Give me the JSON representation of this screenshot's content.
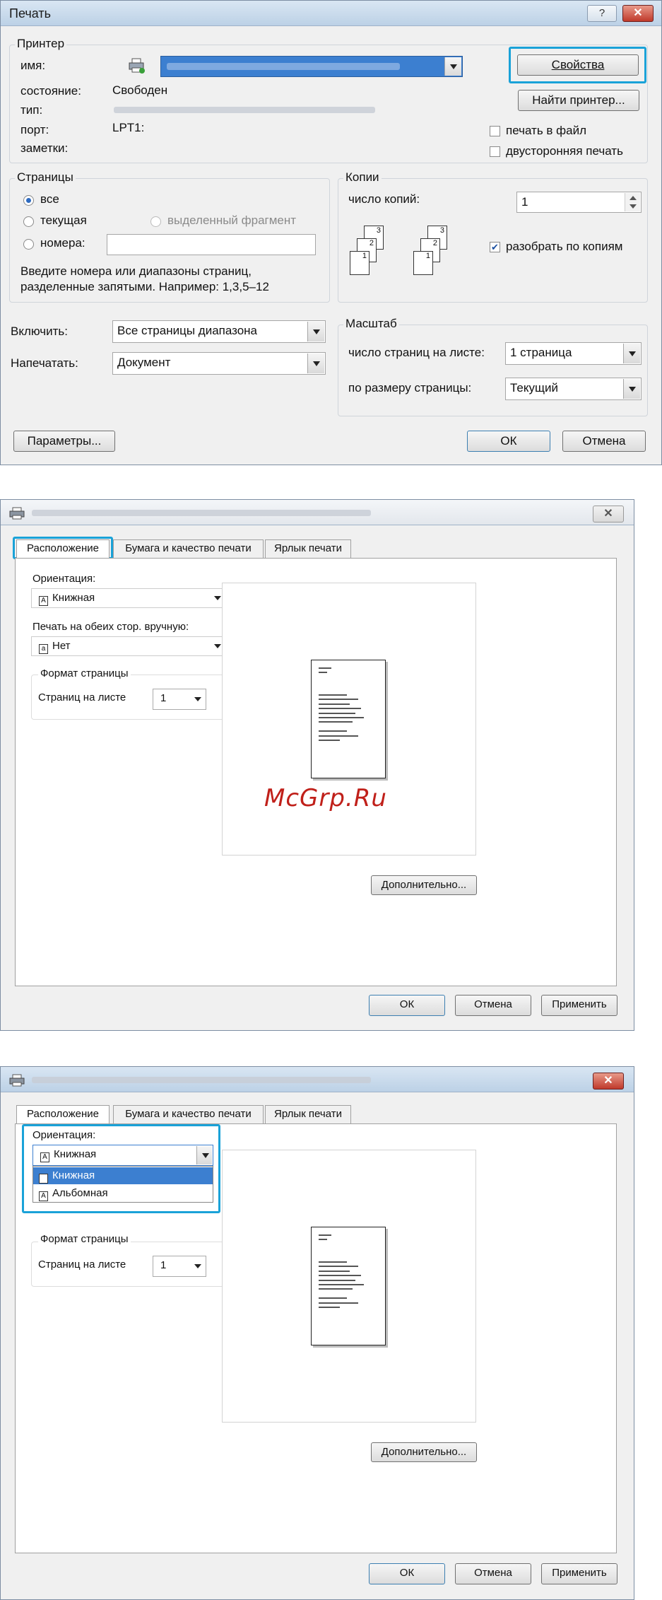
{
  "dialog1": {
    "title": "Печать",
    "printer_group": "Принтер",
    "name_label": "имя:",
    "status_label": "состояние:",
    "status_value": "Свободен",
    "type_label": "тип:",
    "port_label": "порт:",
    "port_value": "LPT1:",
    "notes_label": "заметки:",
    "properties_button": "Свойства",
    "find_printer_button": "Найти принтер...",
    "print_to_file": "печать в файл",
    "duplex": "двусторонняя печать",
    "pages_group": "Страницы",
    "all": "все",
    "current": "текущая",
    "selection": "выделенный фрагмент",
    "pages": "номера:",
    "hint_line1": "Введите номера или диапазоны страниц,",
    "hint_line2": "разделенные запятыми. Например: 1,3,5–12",
    "copies_group": "Копии",
    "copies_label": "число копий:",
    "copies_value": "1",
    "collate": "разобрать по копиям",
    "stack_a": [
      "3",
      "2",
      "1"
    ],
    "stack_b": [
      "3",
      "2",
      "1"
    ],
    "include_label": "Включить:",
    "include_value": "Все страницы диапазона",
    "print_what_label": "Напечатать:",
    "print_what_value": "Документ",
    "zoom_group": "Масштаб",
    "pages_per_sheet_label": "число страниц на листе:",
    "pages_per_sheet_value": "1 страница",
    "scale_label": "по размеру страницы:",
    "scale_value": "Текущий",
    "options_button": "Параметры...",
    "ok_button": "ОК",
    "cancel_button": "Отмена"
  },
  "dialog2": {
    "tabs": [
      "Расположение",
      "Бумага и качество печати",
      "Ярлык печати"
    ],
    "orientation_label": "Ориентация:",
    "orientation_value": "Книжная",
    "manual_duplex_label": "Печать на обеих стор. вручную:",
    "manual_duplex_value": "Нет",
    "format_group": "Формат страницы",
    "pages_per_sheet_label": "Страниц на листе",
    "pages_per_sheet_value": "1",
    "advanced_button": "Дополнительно...",
    "ok_button": "ОК",
    "cancel_button": "Отмена",
    "apply_button": "Применить"
  },
  "watermark": "McGrp.Ru",
  "dialog3": {
    "tabs": [
      "Расположение",
      "Бумага и качество печати",
      "Ярлык печати"
    ],
    "orientation_label": "Ориентация:",
    "orientation_value": "Книжная",
    "options": [
      "Книжная",
      "Альбомная"
    ],
    "format_group": "Формат страницы",
    "pages_per_sheet_label": "Страниц на листе",
    "pages_per_sheet_value": "1",
    "advanced_button": "Дополнительно...",
    "ok_button": "ОК",
    "cancel_button": "Отмена",
    "apply_button": "Применить"
  },
  "icons": {
    "close": "close-icon",
    "help": "help-icon",
    "printer": "printer-icon",
    "portrait": "portrait-page-icon"
  },
  "colors": {
    "highlight": "#1aa2d8",
    "selection": "#3c7fd0"
  }
}
